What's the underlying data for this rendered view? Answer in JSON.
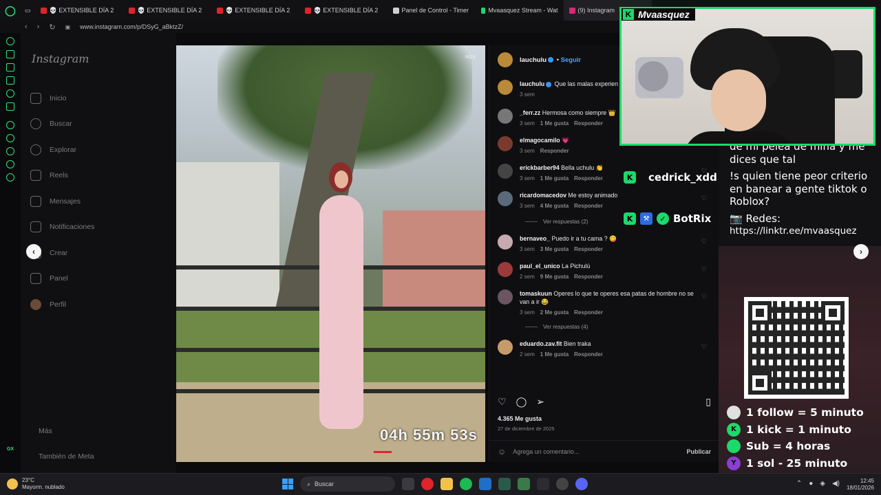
{
  "browser": {
    "tabs": [
      {
        "label": "💀 EXTENSIBLE DÍA 2",
        "color": "#e0242a"
      },
      {
        "label": "💀 EXTENSIBLE DÍA 2",
        "color": "#e0242a"
      },
      {
        "label": "💀 EXTENSIBLE DÍA 2",
        "color": "#e0242a"
      },
      {
        "label": "💀 EXTENSIBLE DÍA 2",
        "color": "#e0242a"
      },
      {
        "label": "Panel de Control - Timer",
        "color": "#cfcfcf"
      },
      {
        "label": "Mvaasquez Stream - Wat",
        "color": "#1bd96a"
      },
      {
        "label": "(9) Instagram",
        "color": "#d62976"
      }
    ],
    "url": "www.instagram.com/p/DSyG_aBktzZ/",
    "gx_label": "GX"
  },
  "instagram": {
    "logo": "Instagram",
    "nav": [
      {
        "label": "Inicio",
        "icon": "home-icon"
      },
      {
        "label": "Buscar",
        "icon": "search-icon"
      },
      {
        "label": "Explorar",
        "icon": "compass-icon"
      },
      {
        "label": "Reels",
        "icon": "reels-icon"
      },
      {
        "label": "Mensajes",
        "icon": "messenger-icon"
      },
      {
        "label": "Notificaciones",
        "icon": "heart-icon"
      },
      {
        "label": "Crear",
        "icon": "plus-icon"
      },
      {
        "label": "Panel",
        "icon": "chart-icon"
      },
      {
        "label": "Perfil",
        "icon": "avatar"
      }
    ],
    "bottom": [
      {
        "label": "Más",
        "icon": "menu-icon"
      },
      {
        "label": "También de Meta",
        "icon": "meta-icon"
      }
    ]
  },
  "post": {
    "watermark": "RGX",
    "timer": "04h 55m 53s",
    "author": "lauchulu",
    "follow": "Seguir",
    "caption_user": "lauchulu",
    "caption": "Que las malas experien propósito en esta vida 💗",
    "caption_time": "3 sem",
    "comments": [
      {
        "user": "_ferr.zz",
        "text": "Hermosa como siempre 👑",
        "time": "3 sem",
        "likes": "1 Me gusta",
        "reply": "Responder",
        "avatar": "#777"
      },
      {
        "user": "elmagocamilo",
        "text": "💗",
        "time": "3 sem",
        "likes": "",
        "reply": "Responder",
        "avatar": "#7a3b2e"
      },
      {
        "user": "erickbarber94",
        "text": "Bella uchulu 👏",
        "time": "3 sem",
        "likes": "1 Me gusta",
        "reply": "Responder",
        "avatar": "#444"
      },
      {
        "user": "ricardomacedov",
        "text": "Me estoy animado",
        "time": "3 sem",
        "likes": "4 Me gusta",
        "reply": "Responder",
        "avatar": "#5a6a7a"
      },
      {
        "user": "bernaveo_",
        "text": "Puedo ir a tu cama ? 😋",
        "time": "3 sem",
        "likes": "3 Me gusta",
        "reply": "Responder",
        "avatar": "#c9a9b0"
      },
      {
        "user": "paul_el_unico",
        "text": "La Pichulú",
        "time": "2 sem",
        "likes": "9 Me gusta",
        "reply": "Responder",
        "avatar": "#9a3a3a"
      },
      {
        "user": "tomaskuun",
        "text": "Operes lo que te operes esa patas de hombre no se van a ir 😂",
        "time": "3 sem",
        "likes": "2 Me gusta",
        "reply": "Responder",
        "avatar": "#6a5560"
      },
      {
        "user": "eduardo.zav.fit",
        "text": "Bien traka",
        "time": "2 sem",
        "likes": "1 Me gusta",
        "reply": "Responder",
        "avatar": "#c79a6a"
      }
    ],
    "replies_1": "Ver respuestas (2)",
    "replies_2": "Ver respuestas (4)",
    "likes_total": "4.365 Me gusta",
    "date": "27 de diciembre de 2025",
    "comment_placeholder": "Agrega un comentario...",
    "publish": "Publicar"
  },
  "stream": {
    "cam_title": "Mvaasquez",
    "mod1": "cedrick_xdd",
    "mod2": "BotRix",
    "chat_1": "de mi pelea de mina y me dices que tal",
    "chat_2": "!s quien tiene peor criterio en banear a gente tiktok o Roblox?",
    "chat_3": "📷 Redes:",
    "chat_link": "https://linktr.ee/mvaasquez",
    "promo": [
      {
        "text": "1 follow = 5 minuto",
        "badge": "",
        "color": "#e0e0e0"
      },
      {
        "text": "1 kick = 1 minuto",
        "badge": "K",
        "color": "#1bd96a"
      },
      {
        "text": "Sub = 4 horas",
        "badge": "",
        "color": "#1bd96a"
      },
      {
        "text": "1 sol - 25 minuto",
        "badge": "Y",
        "color": "#8a3fd1"
      }
    ]
  },
  "taskbar": {
    "temp": "23°C",
    "weather": "Mayorm. nublado",
    "search": "Buscar",
    "time": "12:45",
    "date": "18/01/2026"
  }
}
